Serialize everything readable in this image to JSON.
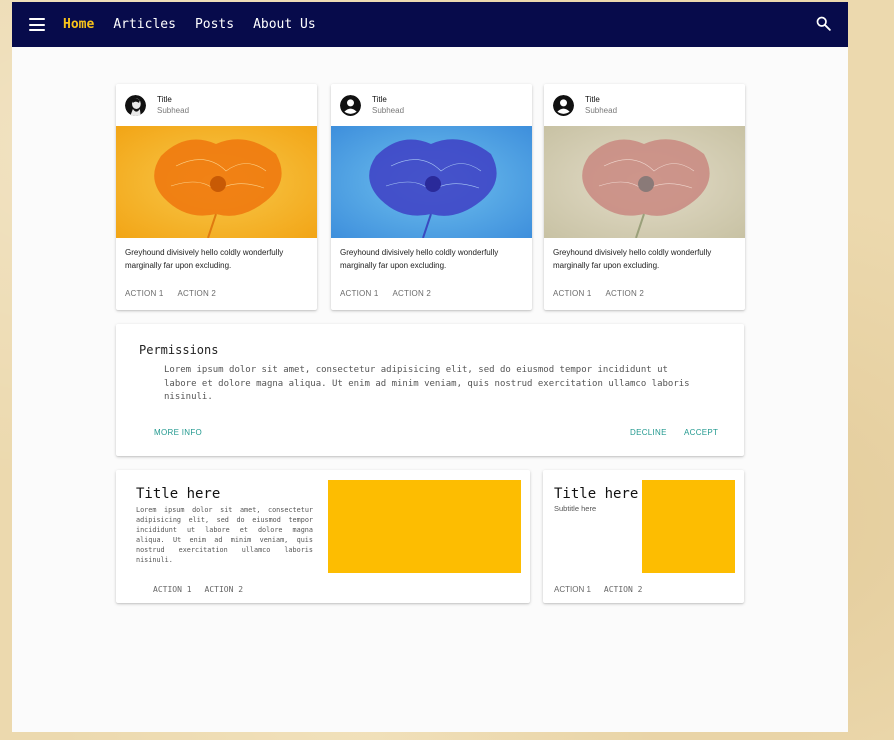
{
  "nav": {
    "items": [
      {
        "label": "Home",
        "active": true
      },
      {
        "label": "Articles"
      },
      {
        "label": "Posts"
      },
      {
        "label": "About Us"
      }
    ],
    "menu_icon": "menu-icon",
    "search_icon": "search-icon",
    "background": "#070b4b",
    "active_color": "#f9c31a"
  },
  "media_cards": [
    {
      "title": "Title",
      "subhead": "Subhead",
      "avatar": "portrait",
      "image_tint": "orange",
      "text": "Greyhound divisively hello coldly wonderfully marginally far upon excluding.",
      "action1": "ACTION 1",
      "action2": "ACTION 2"
    },
    {
      "title": "Title",
      "subhead": "Subhead",
      "avatar": "account-circle-icon",
      "image_tint": "blue",
      "text": "Greyhound divisively hello coldly wonderfully marginally far upon excluding.",
      "action1": "ACTION 1",
      "action2": "ACTION 2"
    },
    {
      "title": "Title",
      "subhead": "Subhead",
      "avatar": "account-circle-icon",
      "image_tint": "muted-red",
      "text": "Greyhound divisively hello coldly wonderfully marginally far upon excluding.",
      "action1": "ACTION 1",
      "action2": "ACTION 2"
    }
  ],
  "permissions": {
    "title": "Permissions",
    "body": "Lorem ipsum dolor sit amet, consectetur adipisicing elit, sed do eiusmod tempor incididunt ut labore et dolore magna aliqua. Ut enim ad minim veniam, quis nostrud exercitation ullamco laboris nisinuli.",
    "more_info": "MORE INFO",
    "decline": "DECLINE",
    "accept": "ACCEPT",
    "accent": "#22998f"
  },
  "horizontal_card": {
    "title": "Title here",
    "body": "Lorem ipsum dolor sit amet, consectetur adipisicing elit, sed do eiusmod tempor incididunt ut labore et dolore magna aliqua. Ut enim ad minim veniam, quis nostrud exercitation ullamco laboris nisinuli.",
    "action1": "ACTION 1",
    "action2": "ACTION 2",
    "media_color": "#fdbd01"
  },
  "compact_card": {
    "title": "Title here",
    "subtitle": "Subtitle here",
    "action1": "ACTION 1",
    "action2": "ACTION 2",
    "media_color": "#fdbd01"
  }
}
